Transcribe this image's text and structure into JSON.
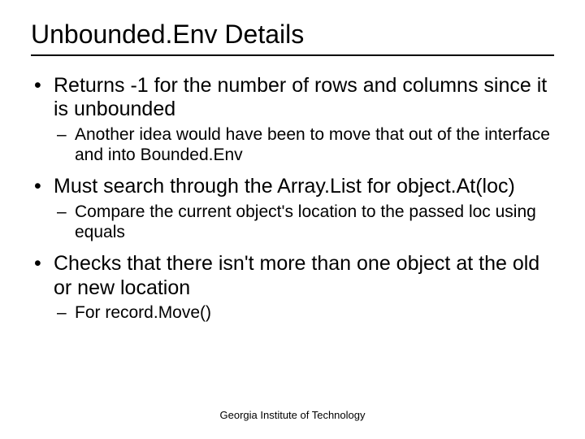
{
  "title": "Unbounded.Env Details",
  "bullets": {
    "b1": "Returns -1 for the number of rows and columns since it is unbounded",
    "b1a": "Another idea would have been to move that out of the interface and into Bounded.Env",
    "b2": "Must search through the Array.List for object.At(loc)",
    "b2a": "Compare the current object's location to the passed loc using equals",
    "b3": "Checks that there isn't more than one object at the old or new location",
    "b3a": "For record.Move()"
  },
  "footer": "Georgia Institute of Technology"
}
